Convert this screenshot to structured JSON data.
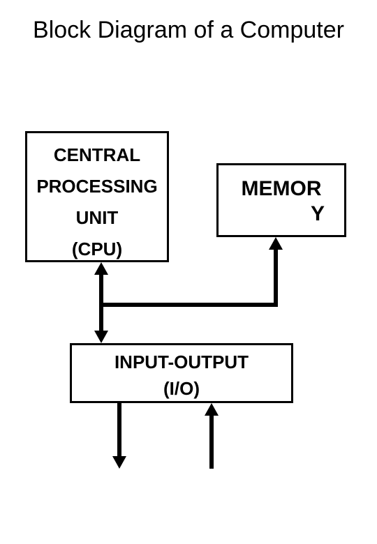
{
  "title": "Block Diagram of a Computer",
  "blocks": {
    "cpu": {
      "line1": "CENTRAL",
      "line2": "PROCESSING",
      "line3": "UNIT",
      "line4": "(CPU)"
    },
    "memory": {
      "line1": "MEMOR",
      "line2": "Y"
    },
    "io": {
      "line1": "INPUT-OUTPUT",
      "line2": "(I/O)"
    }
  }
}
